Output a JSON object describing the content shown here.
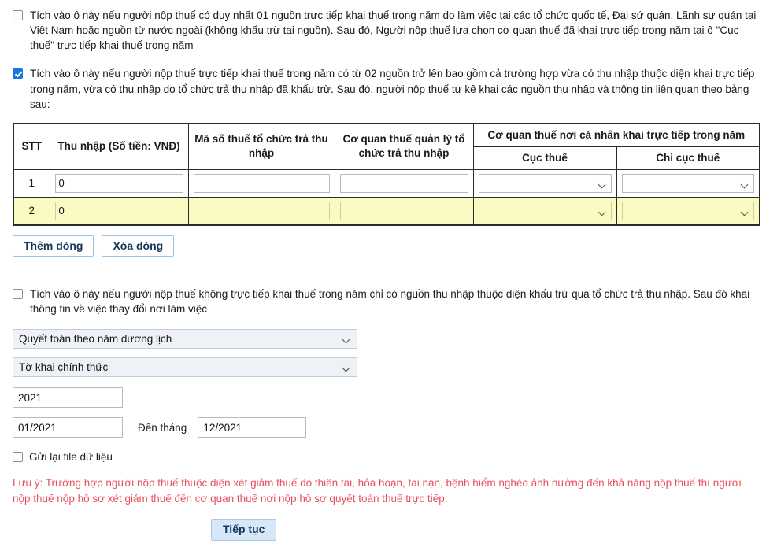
{
  "options": {
    "single_source": {
      "label": "Tích vào ô này nếu người nộp thuế có duy nhất 01 nguồn trực tiếp khai thuế trong năm do làm việc tại các tổ chức quốc tế, Đại sứ quán, Lãnh sự quán tại Việt Nam hoặc nguồn từ nước ngoài (không khấu trừ tại nguồn). Sau đó, Người nộp thuế lựa chọn cơ quan thuế đã khai trực tiếp trong năm tại ô \"Cục thuế\" trực tiếp khai thuế trong năm",
      "checked": false
    },
    "multi_source": {
      "label": "Tích vào ô này nếu người nộp thuế trực tiếp khai thuế trong năm có từ 02 nguồn trở lên bao gồm cả trường hợp vừa có thu nhập thuộc diện khai trực tiếp trong năm, vừa có thu nhập do tổ chức trả thu nhập đã khấu trừ. Sau đó, người nộp thuế tự kê khai các nguồn thu nhập và thông tin liên quan theo bảng sau:",
      "checked": true
    },
    "withheld_only": {
      "label": "Tích vào ô này nếu người nộp thuế không trực tiếp khai thuế trong năm chỉ có nguồn thu nhập thuộc diện khấu trừ qua tổ chức trả thu nhập. Sau đó khai thông tin về việc thay đổi nơi làm việc",
      "checked": false
    }
  },
  "table": {
    "headers": {
      "stt": "STT",
      "income": "Thu nhập (Số tiền: VNĐ)",
      "tax_code": "Mã số thuế tổ chức trả thu nhập",
      "managing_agency": "Cơ quan thuế quản lý tổ chức trả thu nhập",
      "direct_agency": "Cơ quan thuế nơi cá nhân khai trực tiếp trong năm",
      "department": "Cục thuế",
      "sub_department": "Chi cục thuế"
    },
    "rows": [
      {
        "stt": "1",
        "income": "0",
        "tax_code": "",
        "managing_agency": "",
        "department": "",
        "sub_department": "",
        "highlighted": false
      },
      {
        "stt": "2",
        "income": "0",
        "tax_code": "",
        "managing_agency": "",
        "department": "",
        "sub_department": "",
        "highlighted": true
      }
    ],
    "buttons": {
      "add_row": "Thêm dòng",
      "delete_row": "Xóa dòng"
    }
  },
  "form": {
    "settlement_type": "Quyết toán theo năm dương lịch",
    "declaration_type": "Tờ khai chính thức",
    "year": "2021",
    "month_from": "01/2021",
    "month_to_label": "Đến tháng",
    "month_to": "12/2021",
    "resend_file": "Gửi lại file dữ liệu",
    "resend_checked": false
  },
  "note": "Lưu ý: Trường hợp người nộp thuế thuộc diện xét giảm thuế do thiên tai, hỏa hoạn, tai nạn, bệnh hiểm nghèo ảnh hưởng đến khả năng nộp thuế thì người nộp thuế nộp hồ sơ xét giảm thuế đến cơ quan thuế nơi nộp hồ sơ quyết toán thuế trực tiếp.",
  "submit": "Tiếp tục",
  "colors": {
    "accent": "#1478dc",
    "highlight_row": "#fafac3",
    "note": "#e8505b",
    "button_text": "#14365c",
    "primary_button_bg": "#d6e7f7"
  }
}
